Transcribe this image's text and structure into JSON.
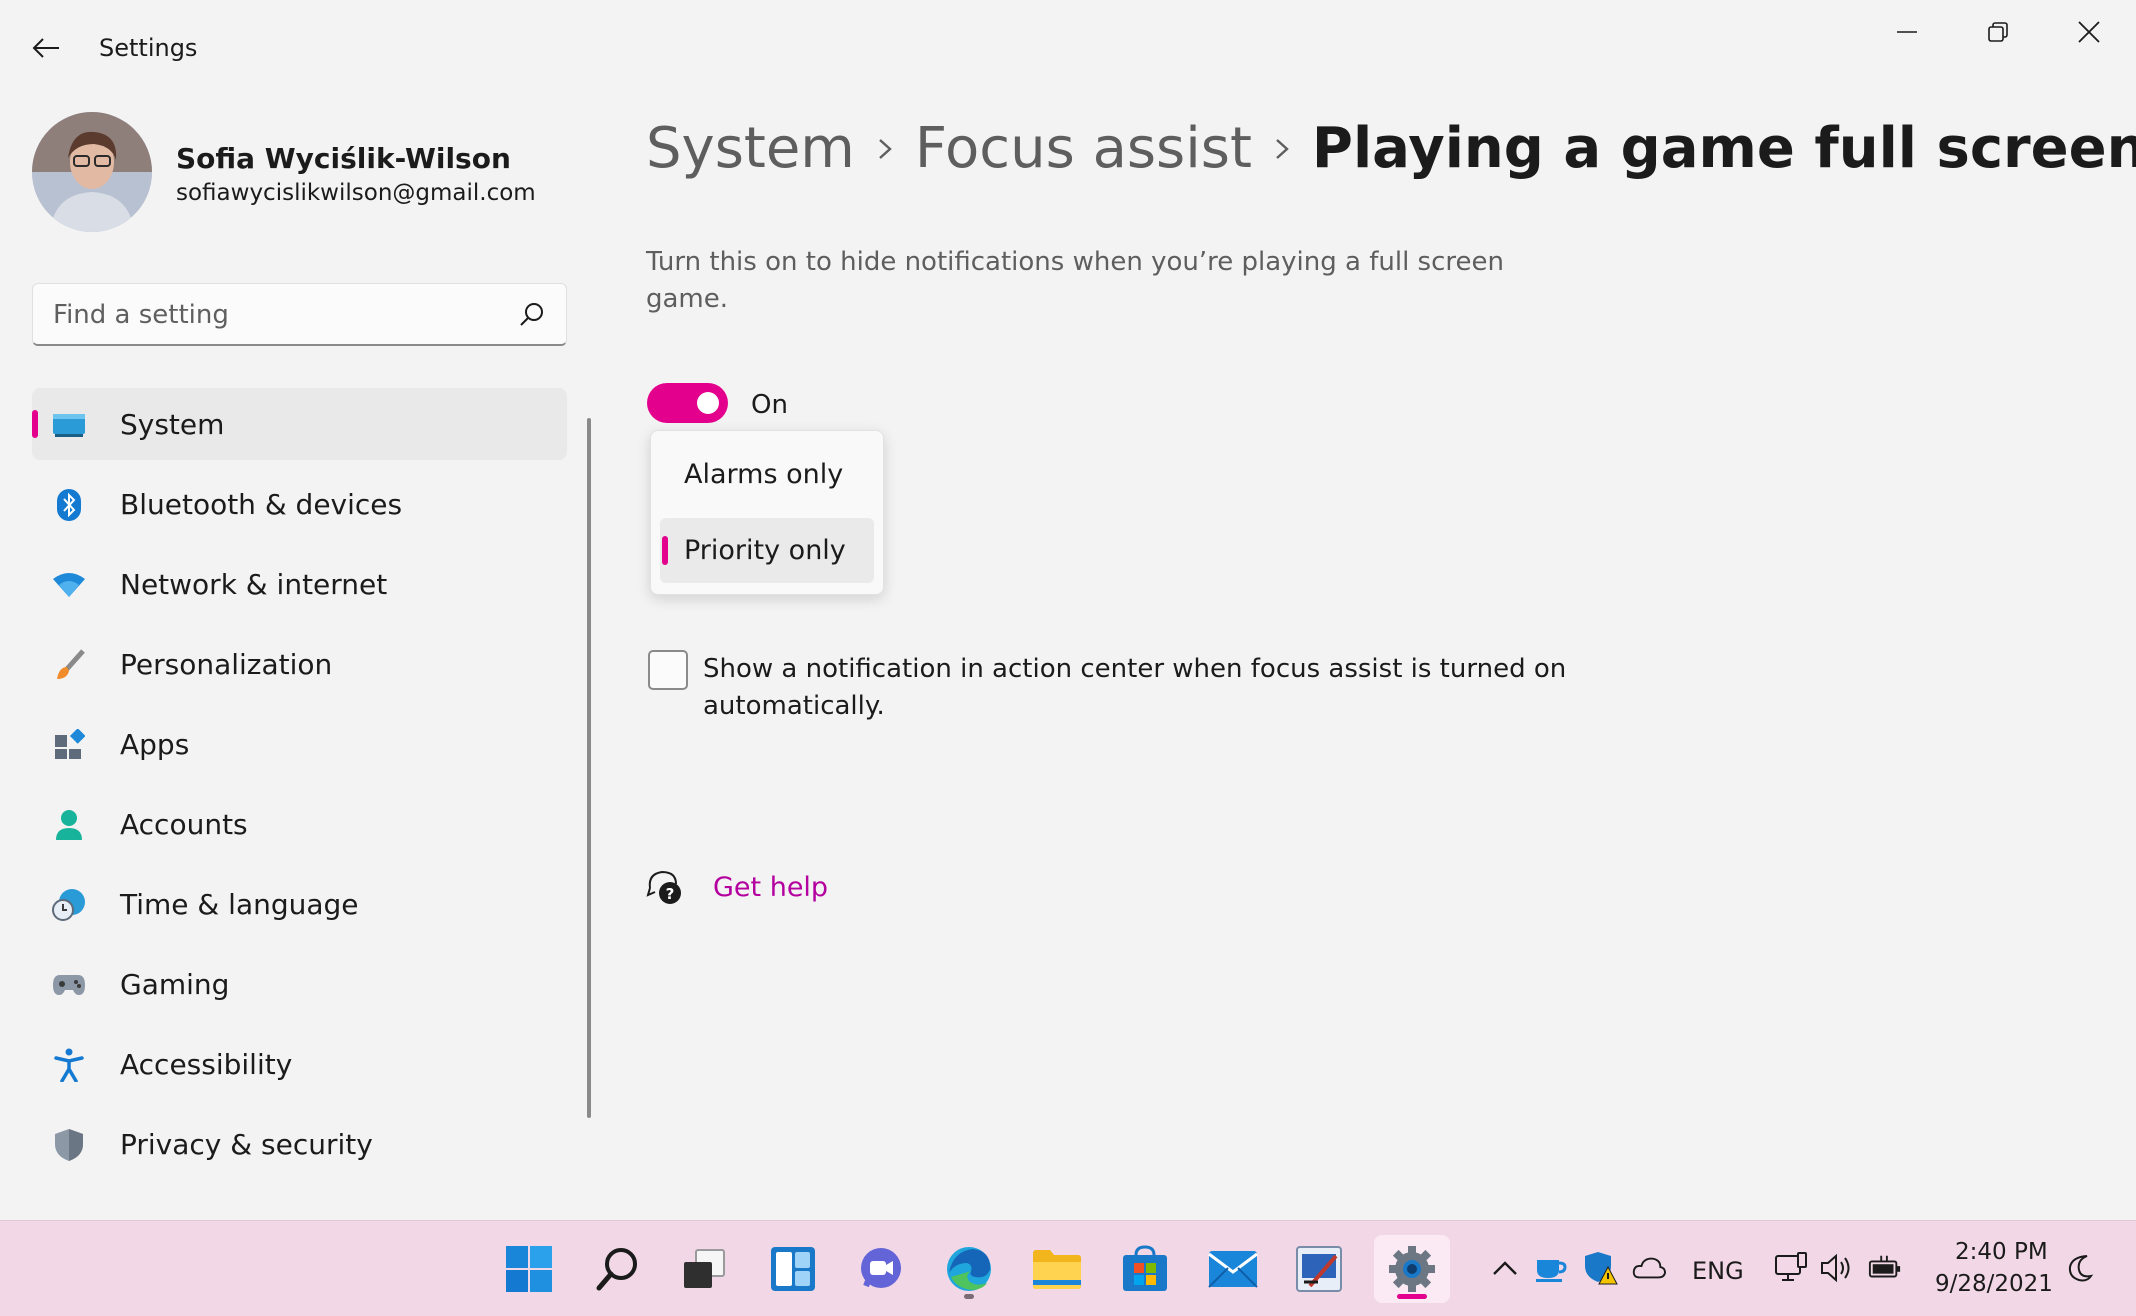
{
  "window": {
    "title": "Settings",
    "minimize_icon": "minimize-icon",
    "maximize_icon": "restore-icon",
    "close_icon": "close-icon"
  },
  "profile": {
    "name": "Sofia Wyciślik-Wilson",
    "email": "sofiawycislikwilson@gmail.com"
  },
  "search": {
    "placeholder": "Find a setting"
  },
  "sidebar": {
    "items": [
      {
        "label": "System",
        "icon": "monitor-icon",
        "selected": true
      },
      {
        "label": "Bluetooth & devices",
        "icon": "bluetooth-icon"
      },
      {
        "label": "Network & internet",
        "icon": "wifi-icon"
      },
      {
        "label": "Personalization",
        "icon": "paintbrush-icon"
      },
      {
        "label": "Apps",
        "icon": "apps-icon"
      },
      {
        "label": "Accounts",
        "icon": "person-icon"
      },
      {
        "label": "Time & language",
        "icon": "clock-globe-icon"
      },
      {
        "label": "Gaming",
        "icon": "gamepad-icon"
      },
      {
        "label": "Accessibility",
        "icon": "accessibility-icon"
      },
      {
        "label": "Privacy & security",
        "icon": "shield-icon"
      }
    ]
  },
  "breadcrumb": {
    "items": [
      "System",
      "Focus assist",
      "Playing a game full screen"
    ]
  },
  "main": {
    "description": "Turn this on to hide notifications when you’re playing a full screen game.",
    "toggle_label": "On",
    "toggle_on": true,
    "dropdown": {
      "options": [
        "Alarms only",
        "Priority only"
      ],
      "selected": "Priority only"
    },
    "checkbox_label": "Show a notification in action center when focus assist is turned on automatically.",
    "checkbox_checked": false,
    "help_label": "Get help"
  },
  "taskbar": {
    "apps": [
      "windows-start-icon",
      "search-icon",
      "task-view-icon",
      "widgets-icon",
      "teams-chat-icon",
      "edge-icon",
      "file-explorer-icon",
      "store-icon",
      "mail-icon",
      "snipping-tool-icon",
      "settings-icon"
    ],
    "language": "ENG",
    "time": "2:40 PM",
    "date": "9/28/2021"
  },
  "colors": {
    "accent": "#e3008c",
    "link": "#b4009e",
    "background": "#f3f3f3",
    "taskbar": "#f2d8e6"
  }
}
